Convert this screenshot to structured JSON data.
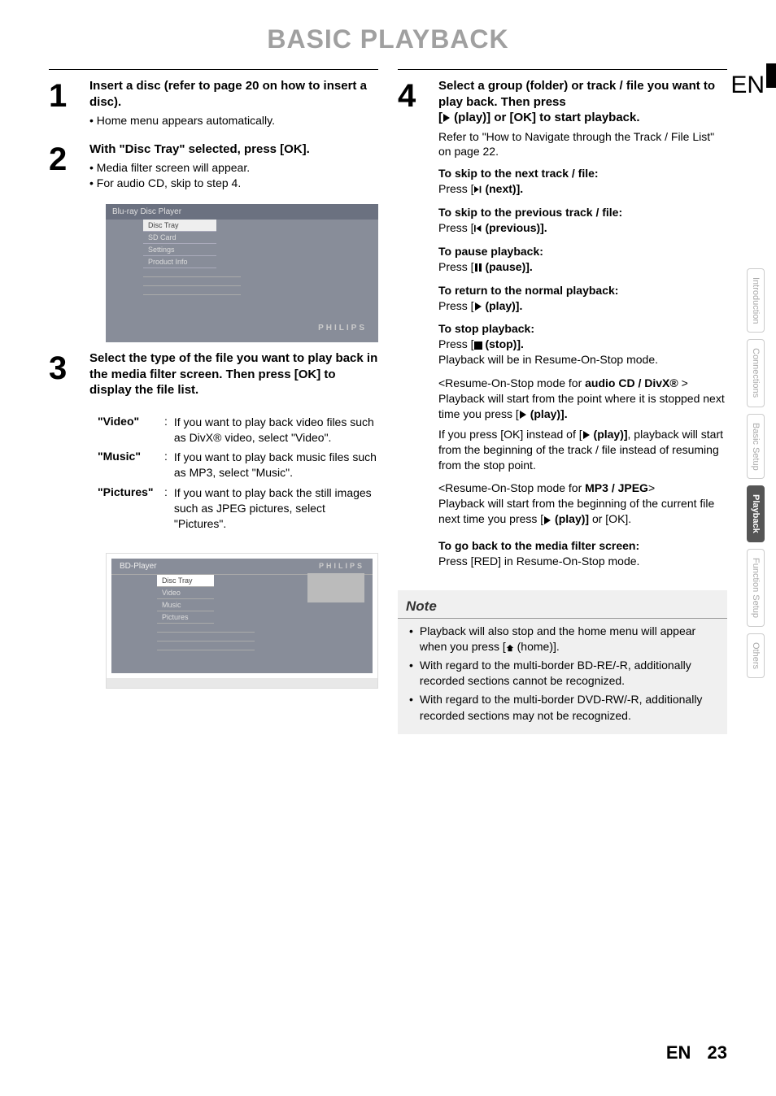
{
  "page": {
    "title": "BASIC PLAYBACK",
    "lang_corner": "EN",
    "footer_lang": "EN",
    "footer_page": "23"
  },
  "side_tabs": [
    "Introduction",
    "Connections",
    "Basic Setup",
    "Playback",
    "Function Setup",
    "Others"
  ],
  "side_tab_active": 3,
  "step1": {
    "num": "1",
    "heading": "Insert a disc (refer to page 20 on how to insert a disc).",
    "bullets": [
      "Home menu appears automatically."
    ]
  },
  "step2": {
    "num": "2",
    "heading": "With \"Disc Tray\" selected, press [OK].",
    "bullets": [
      "Media filter screen will appear.",
      "For audio CD, skip to step 4."
    ],
    "mock": {
      "title": "Blu-ray Disc Player",
      "items": [
        "Disc Tray",
        "SD Card",
        "Settings",
        "Product Info"
      ],
      "brand": "PHILIPS"
    }
  },
  "step3": {
    "num": "3",
    "heading": "Select the type of the file you want to play back in the media filter screen. Then press [OK] to display the file list.",
    "defs": [
      {
        "term": "\"Video\"",
        "desc": "If you want to play back video files such as DivX® video, select \"Video\"."
      },
      {
        "term": "\"Music\"",
        "desc": "If you want to play back music files such as MP3, select \"Music\"."
      },
      {
        "term": "\"Pictures\"",
        "desc": "If you want to play back the still images such as JPEG pictures, select \"Pictures\"."
      }
    ],
    "mock": {
      "header": "BD-Player",
      "brand": "PHILIPS",
      "items": [
        "Disc Tray",
        "Video",
        "Music",
        "Pictures"
      ]
    }
  },
  "step4": {
    "num": "4",
    "heading_l1": "Select a group (folder) or track / file you want to play back. Then press",
    "heading_l2_prefix": "[",
    "heading_l2_label": " (play)] or [OK] to start playback.",
    "refer": "Refer to \"How to Navigate through the Track / File List\" on page 22.",
    "skip_next_h": "To skip to the next track / file:",
    "skip_next_t_pre": "Press [",
    "skip_next_t_lbl": " (next)].",
    "skip_prev_h": "To skip to the previous track / file:",
    "skip_prev_t_pre": "Press [",
    "skip_prev_t_lbl": " (previous)].",
    "pause_h": "To pause playback:",
    "pause_t_pre": "Press [",
    "pause_t_lbl": " (pause)].",
    "resume_h": "To return to the normal playback:",
    "resume_t_pre": "Press [",
    "resume_t_lbl": " (play)].",
    "stop_h": "To stop playback:",
    "stop_t_pre": "Press [",
    "stop_t_lbl": " (stop)].",
    "stop_note": "Playback will be in Resume-On-Stop mode.",
    "ros_cd_h_pre": "<Resume-On-Stop mode for ",
    "ros_cd_h_bold": "audio CD / DivX®",
    "ros_cd_h_post": " >",
    "ros_cd_t1_pre": "Playback will start from the point where it is stopped next time you press [",
    "ros_cd_t1_lbl": " (play)].",
    "ros_cd_t2_pre": "If you press [OK] instead of [",
    "ros_cd_t2_lbl": " (play)]",
    "ros_cd_t2_post": ", playback will start from the beginning of the track / file instead of resuming from the stop point.",
    "ros_mp3_h_pre": "<Resume-On-Stop mode for ",
    "ros_mp3_h_bold": "MP3 / JPEG",
    "ros_mp3_h_post": ">",
    "ros_mp3_t_pre": "Playback will start from the beginning of the current file next time you press [",
    "ros_mp3_t_lbl": " (play)]",
    "ros_mp3_t_post": " or [OK].",
    "back_h": "To go back to the media filter screen:",
    "back_t": "Press [RED] in Resume-On-Stop mode."
  },
  "note": {
    "title": "Note",
    "items": [
      {
        "pre": "Playback will also stop and the home menu will appear when you press [",
        "lbl": " (home)].",
        "icon": "home"
      },
      {
        "pre": "With regard to the multi-border BD-RE/-R, additionally recorded sections cannot be recognized."
      },
      {
        "pre": "With regard to the multi-border DVD-RW/-R, additionally recorded sections may not be recognized."
      }
    ]
  }
}
